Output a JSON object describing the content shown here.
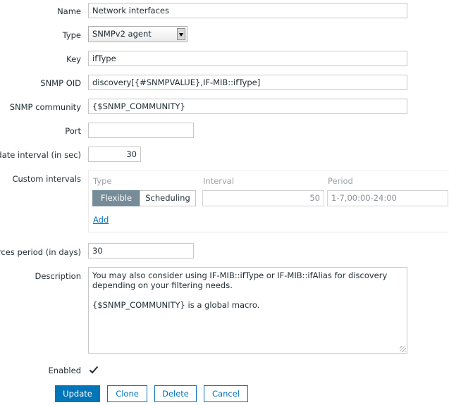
{
  "form": {
    "name": {
      "label": "Name",
      "value": "Network interfaces"
    },
    "type": {
      "label": "Type",
      "value": "SNMPv2 agent"
    },
    "key": {
      "label": "Key",
      "value": "ifType"
    },
    "snmp_oid": {
      "label": "SNMP OID",
      "value": "discovery[{#SNMPVALUE},IF-MIB::ifType]"
    },
    "snmp_community": {
      "label": "SNMP community",
      "value": "{$SNMP_COMMUNITY}"
    },
    "port": {
      "label": "Port",
      "value": ""
    },
    "update_interval": {
      "label": "pdate interval (in sec)",
      "value": "30"
    },
    "custom_intervals": {
      "label": "Custom intervals",
      "headers": {
        "type": "Type",
        "interval": "Interval",
        "period": "Period"
      },
      "type_options": [
        "Flexible",
        "Scheduling"
      ],
      "selected_type": "Flexible",
      "interval_value": "50",
      "period_value": "1-7,00:00-24:00",
      "add_link": "Add"
    },
    "keep_lost": {
      "label": "urces period (in days)",
      "value": "30"
    },
    "description": {
      "label": "Description",
      "line1": "You may also consider using IF-MIB::ifType or IF-MIB::ifAlias for discovery",
      "line2": "depending on your filtering needs.",
      "line3": "{$SNMP_COMMUNITY} is a global macro."
    },
    "enabled": {
      "label": "Enabled",
      "checked": true
    }
  },
  "buttons": {
    "update": "Update",
    "clone": "Clone",
    "delete": "Delete",
    "cancel": "Cancel"
  },
  "colors": {
    "accent": "#0275b8",
    "segment_active": "#768d99"
  },
  "icons": {
    "checkbox": "checkmark-icon",
    "select_arrow": "chevron-down-icon",
    "resize": "resize-grip-icon"
  }
}
